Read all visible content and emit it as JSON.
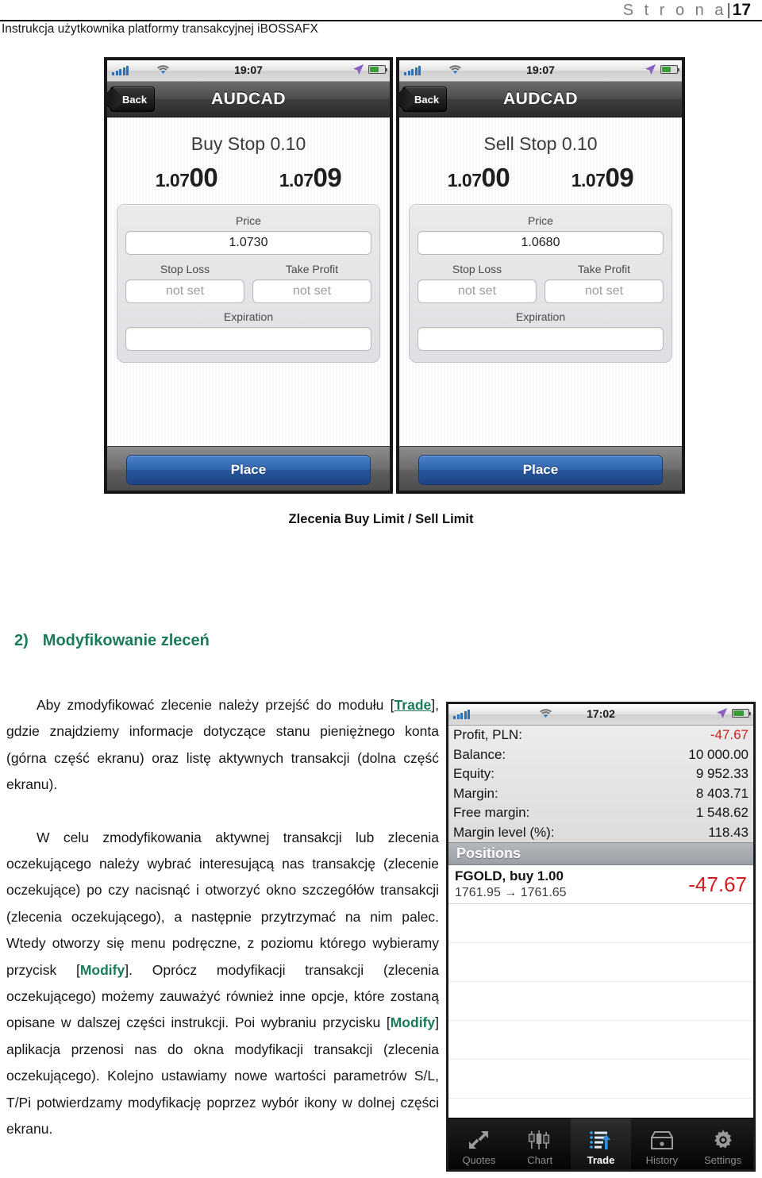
{
  "page_header": {
    "page_label": "S t r o n a",
    "separator": "|",
    "page_number": "17",
    "document_title": "Instrukcja użytkownika platformy transakcyjnej iBOSSAFX"
  },
  "figure_top": {
    "caption": "Zlecenia Buy Limit / Sell Limit",
    "screens": [
      {
        "status_bar": {
          "time": "19:07"
        },
        "nav": {
          "back_label": "Back",
          "title": "AUDCAD"
        },
        "order_title": "Buy Stop 0.10",
        "bid": {
          "small": "1.07",
          "big": "00"
        },
        "ask": {
          "small": "1.07",
          "big": "09"
        },
        "price_label": "Price",
        "price_value": "1.0730",
        "stop_loss_label": "Stop Loss",
        "stop_loss_value": "not set",
        "take_profit_label": "Take Profit",
        "take_profit_value": "not set",
        "expiration_label": "Expiration",
        "expiration_value": "",
        "place_label": "Place"
      },
      {
        "status_bar": {
          "time": "19:07"
        },
        "nav": {
          "back_label": "Back",
          "title": "AUDCAD"
        },
        "order_title": "Sell Stop 0.10",
        "bid": {
          "small": "1.07",
          "big": "00"
        },
        "ask": {
          "small": "1.07",
          "big": "09"
        },
        "price_label": "Price",
        "price_value": "1.0680",
        "stop_loss_label": "Stop Loss",
        "stop_loss_value": "not set",
        "take_profit_label": "Take Profit",
        "take_profit_value": "not set",
        "expiration_label": "Expiration",
        "expiration_value": "",
        "place_label": "Place"
      }
    ]
  },
  "section": {
    "number": "2)",
    "title": "Modyfikowanie zleceń"
  },
  "body": {
    "p1_a": "Aby zmodyfikować zlecenie należy przejść do modułu [",
    "p1_link": "Trade",
    "p1_b": "], gdzie znajdziemy informacje dotyczące stanu pieniężnego konta (górna część ekranu) oraz listę aktywnych transakcji (dolna część ekranu).",
    "p2_a": "W celu zmodyfikowania aktywnej transakcji lub zlecenia oczekującego należy wybrać interesującą nas transakcję (zlecenie oczekujące) po czy nacisnąć i otworzyć okno szczegółów transakcji (zlecenia oczekującego), a następnie przytrzymać na nim palec. Wtedy otworzy się menu podręczne, z poziomu którego wybieramy przycisk [",
    "p2_kw1": "Modify",
    "p2_b": "]. Oprócz modyfikacji transakcji (zlecenia oczekującego) możemy zauważyć również inne opcje, które zostaną opisane w dalszej części instrukcji. Poi wybraniu przycisku [",
    "p2_kw2": "Modify",
    "p2_c": "] aplikacja przenosi nas do okna modyfikacji transakcji (zlecenia oczekującego). Kolejno ustawiamy nowe wartości parametrów S/L, T/Pi potwierdzamy modyfikację poprzez wybór ikony w dolnej części ekranu."
  },
  "trade_screen": {
    "status_bar": {
      "time": "17:02"
    },
    "account": [
      {
        "label": "Profit, PLN:",
        "value": "-47.67",
        "negative": true
      },
      {
        "label": "Balance:",
        "value": "10 000.00",
        "negative": false
      },
      {
        "label": "Equity:",
        "value": "9 952.33",
        "negative": false
      },
      {
        "label": "Margin:",
        "value": "8 403.71",
        "negative": false
      },
      {
        "label": "Free margin:",
        "value": "1 548.62",
        "negative": false
      },
      {
        "label": "Margin level (%):",
        "value": "118.43",
        "negative": false
      }
    ],
    "positions_header": "Positions",
    "positions": [
      {
        "symbol": "FGOLD, buy 1.00",
        "prices": "1761.95 → 1761.65",
        "profit": "-47.67"
      }
    ],
    "tabs": [
      {
        "label": "Quotes",
        "icon": "quotes-arrows-icon",
        "active": false
      },
      {
        "label": "Chart",
        "icon": "candlestick-icon",
        "active": false
      },
      {
        "label": "Trade",
        "icon": "trade-list-icon",
        "active": true
      },
      {
        "label": "History",
        "icon": "archive-box-icon",
        "active": false
      },
      {
        "label": "Settings",
        "icon": "gear-icon",
        "active": false
      }
    ]
  },
  "colors": {
    "accent_green": "#1b7a5a",
    "negative_red": "#cc2121",
    "place_blue": "#2f64ad"
  }
}
